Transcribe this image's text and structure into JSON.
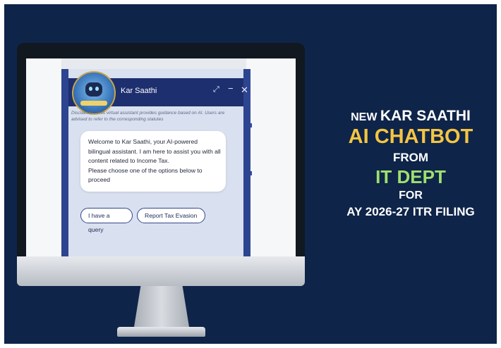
{
  "chatbot": {
    "title": "Kar Saathi",
    "expand_icon": "expand-icon",
    "minimize_icon": "minimize-icon",
    "close_icon": "close-icon",
    "disclaimer": "Disclaimer : This virtual assistant provides guidance based on AI. Users are advised to refer to the corresponding statutes",
    "welcome_lines": [
      "Welcome to Kar Saathi, your AI-powered",
      "bilingual assistant. I am here to assist you with all",
      "content related to Income Tax.",
      "Please choose one of the options below to",
      "proceed"
    ],
    "options": [
      "I have a query",
      "Report Tax Evasion"
    ]
  },
  "headline": {
    "line1_prefix": "NEW",
    "line1_main": "KAR SAATHI",
    "line2": "AI CHATBOT",
    "line3": "FROM",
    "line4": "IT DEPT",
    "line5": "FOR",
    "line6": "AY 2026-27 ITR FILING"
  },
  "colors": {
    "background": "#0e2449",
    "header": "#1d2f6e",
    "accent_yellow": "#f4c542",
    "accent_green": "#9ee06e"
  }
}
